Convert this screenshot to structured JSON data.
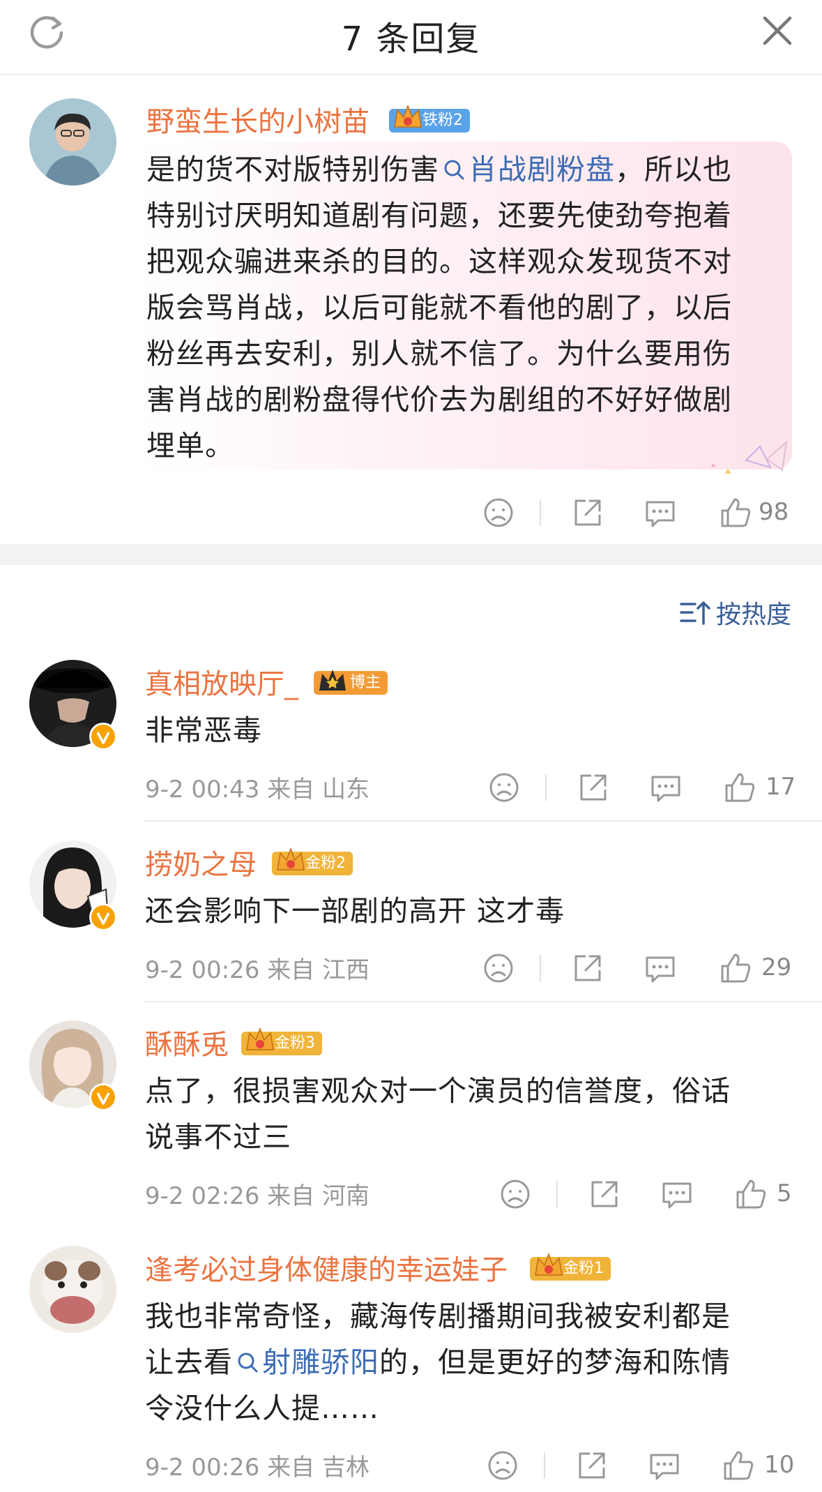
{
  "header": {
    "title": "7 条回复",
    "refresh_icon": "refresh-icon",
    "close_icon": "close-icon"
  },
  "main_comment": {
    "username": "野蛮生长的小树苗",
    "badge": "铁粉2",
    "badge_color": "#5ba3e8",
    "text_before_topic": "是的货不对版特别伤害",
    "topic": "肖战剧粉盘",
    "lines": [
      "，所以也",
      "特别讨厌明知道剧有问题，还要先使劲夸抱着",
      "把观众骗进来杀的目的。这样观众发现货不对",
      "版会骂肖战，以后可能就不看他的剧了，以后",
      "粉丝再去安利，别人就不信了。为什么要用伤",
      "害肖战的剧粉盘得代价去为剧组的不好好做剧",
      "埋单。"
    ],
    "likes": "98"
  },
  "sort": {
    "label": "按热度"
  },
  "replies": [
    {
      "username": "真相放映厅_",
      "badge": "博主",
      "text": [
        "非常恶毒"
      ],
      "time": "9-2 00:43",
      "location_prefix": "来自",
      "location": "山东",
      "likes": "17"
    },
    {
      "username": "捞奶之母",
      "badge": "金粉2",
      "text": [
        "还会影响下一部剧的高开 这才毒"
      ],
      "time": "9-2 00:26",
      "location_prefix": "来自",
      "location": "江西",
      "likes": "29"
    },
    {
      "username": "酥酥兎",
      "badge": "金粉3",
      "text": [
        "点了，很损害观众对一个演员的信誉度，俗话",
        "说事不过三"
      ],
      "time": "9-2 02:26",
      "location_prefix": "来自",
      "location": "河南",
      "likes": "5"
    },
    {
      "username": "逢考必过身体健康的幸运娃子",
      "badge": "金粉1",
      "text_line1": "我也非常奇怪，藏海传剧播期间我被安利都是",
      "text_line2_before": "让去看",
      "topic": "射雕骄阳",
      "text_line2_after": "的，但是更好的梦海和陈情",
      "text_line3": "令没什么人提……",
      "time": "9-2 00:26",
      "location_prefix": "来自",
      "location": "吉林",
      "likes": "10"
    }
  ],
  "colors": {
    "username": "#eb7340",
    "topic_link": "#3d6cb5",
    "gold_badge": "#f0b43a",
    "verified": "#f7a200"
  }
}
